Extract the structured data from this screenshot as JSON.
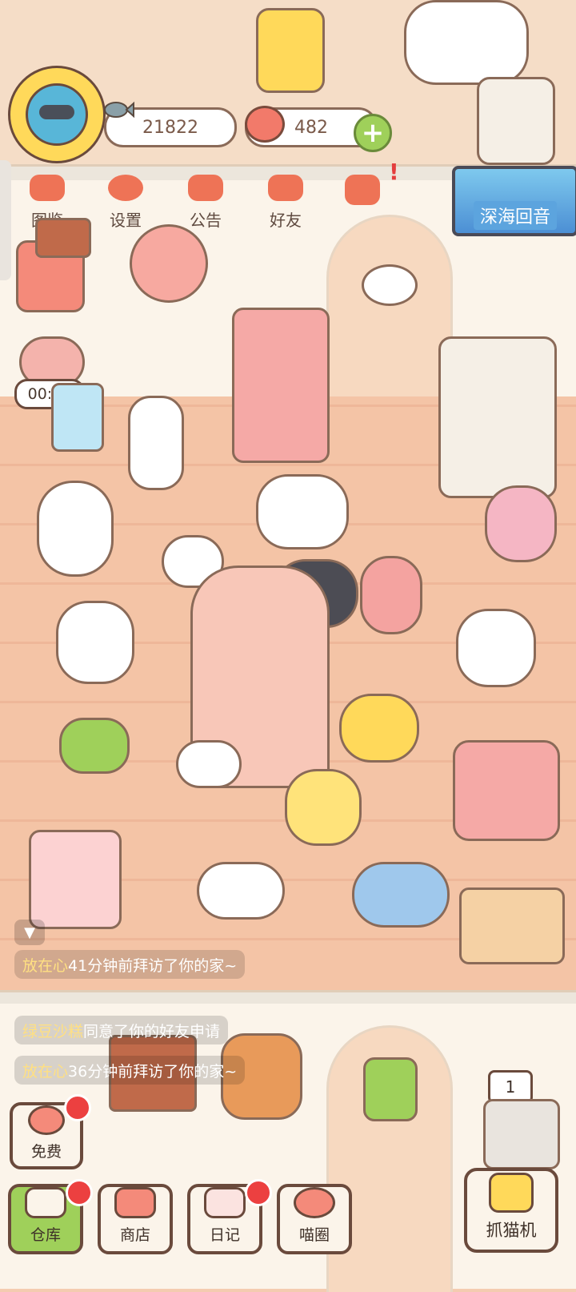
{
  "header": {
    "coins": "21822",
    "hearts": "482"
  },
  "top_menu": {
    "items": [
      {
        "label": "图鉴",
        "icon": "cat-book-icon"
      },
      {
        "label": "设置",
        "icon": "gear-icon"
      },
      {
        "label": "公告",
        "icon": "gift-icon"
      },
      {
        "label": "好友",
        "icon": "friends-icon"
      },
      {
        "label": "",
        "icon": "hearts-icon"
      }
    ],
    "badge": "!"
  },
  "event_banner": {
    "label": "深海回音"
  },
  "timer": {
    "value": "00:37"
  },
  "messages": [
    {
      "name": "放在心",
      "text": "41分钟前拜访了你的家~"
    },
    {
      "name": "绿豆沙糕",
      "text": "同意了你的好友申请"
    },
    {
      "name": "放在心",
      "text": "36分钟前拜访了你的家~"
    }
  ],
  "bottom_bar": {
    "free": "免费",
    "warehouse": "仓库",
    "shop": "商店",
    "diary": "日记",
    "circle": "喵圈",
    "claw": "抓猫机",
    "claw_count": "1"
  },
  "colors": {
    "accent_orange": "#ee7356",
    "green": "#9fd05a",
    "notification_red": "#ec4040",
    "outline": "#6a4a3c"
  }
}
